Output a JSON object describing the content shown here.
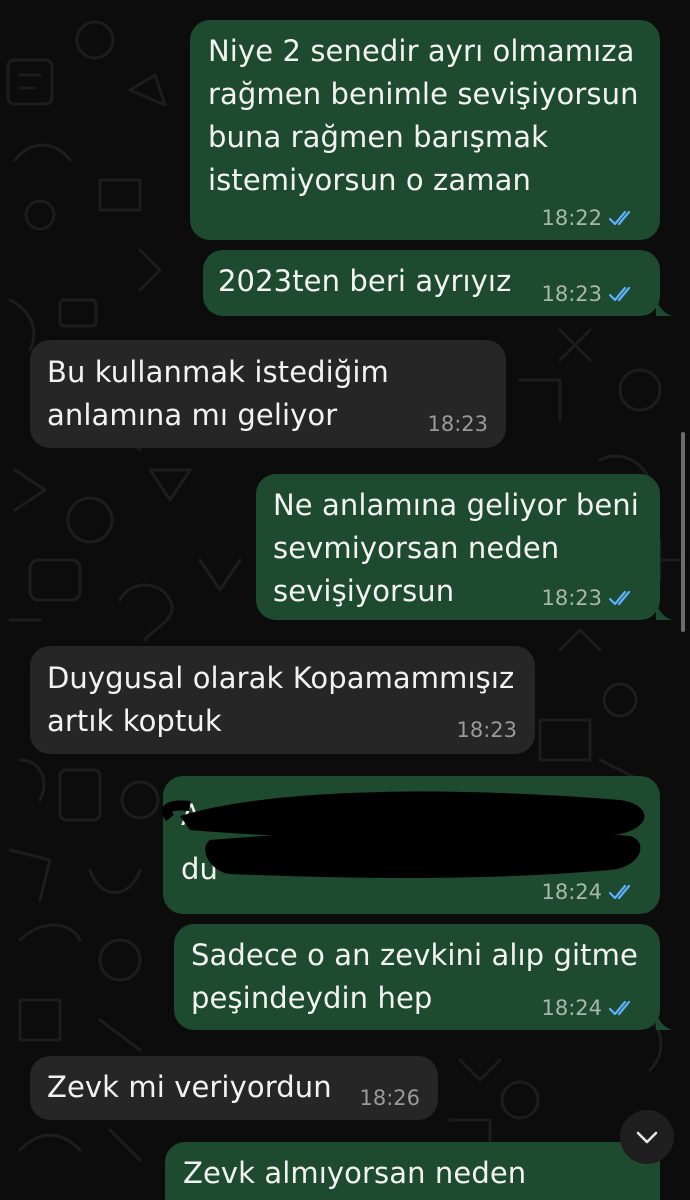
{
  "messages": [
    {
      "dir": "out",
      "text": "Niye 2 senedir ayrı olmamıza\nrağmen benimle sevişiyorsun\nbuna rağmen barışmak\nistemiyorsun o zaman",
      "time": "18:22",
      "status": "read"
    },
    {
      "dir": "out",
      "text": "2023ten beri ayrıyız",
      "time": "18:23",
      "status": "read"
    },
    {
      "dir": "in",
      "text": "Bu kullanmak istediğim\nanlamına mı geliyor",
      "time": "18:23"
    },
    {
      "dir": "out",
      "text": "Ne anlamına geliyor beni\nsevmiyorsan neden\nsevişiyorsun",
      "time": "18:23",
      "status": "read"
    },
    {
      "dir": "in",
      "text": "Duygusal olarak Kopamammışız\nartık koptuk",
      "time": "18:23"
    },
    {
      "dir": "out",
      "text": "A\ndu",
      "time": "18:24",
      "status": "read",
      "redacted": true
    },
    {
      "dir": "out",
      "text": "Sadece o an zevkini alıp gitme\npeşindeydin hep",
      "time": "18:24",
      "status": "read"
    },
    {
      "dir": "in",
      "text": "Zevk mi veriyordun",
      "time": "18:26"
    },
    {
      "dir": "out",
      "text": "Zevk almıyorsan neden seviştin",
      "time": "",
      "status": ""
    }
  ],
  "colors": {
    "outgoing_bubble": "#1e4a2f",
    "incoming_bubble": "#262626",
    "read_ticks": "#5fb0ff",
    "background": "#0c0c0c"
  },
  "icons": {
    "scroll_down": "chevron-down-icon",
    "read_receipt": "double-check-icon"
  }
}
